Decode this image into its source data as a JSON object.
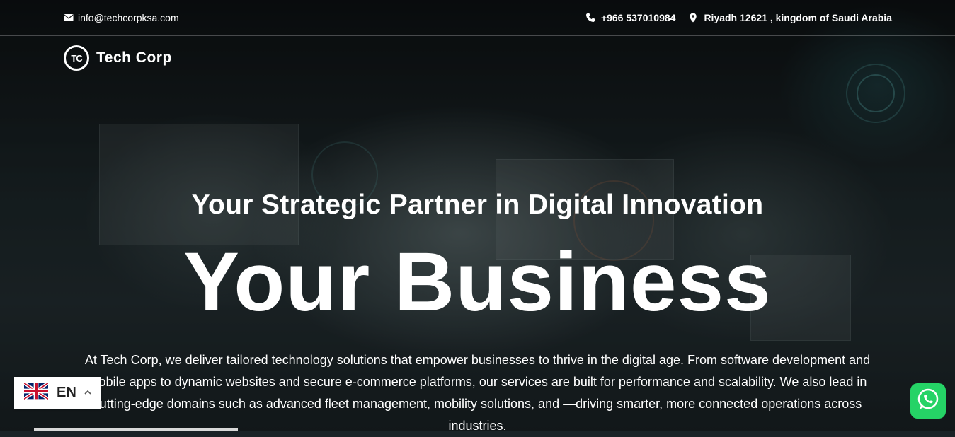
{
  "topbar": {
    "email": "info@techcorpksa.com",
    "phone": "+966 537010984",
    "address": "Riyadh 12621 , kingdom of Saudi Arabia"
  },
  "logo": {
    "mark": "TC",
    "name": "Tech Corp"
  },
  "hero": {
    "subtitle": "Your Strategic Partner in Digital Innovation",
    "title": "Your Business",
    "description": "At Tech Corp, we deliver tailored technology solutions that empower businesses to thrive in the digital age. From software development and mobile apps to dynamic websites and secure e-commerce platforms, our services are built for performance and scalability. We also lead in cutting-edge domains such as advanced fleet management, mobility solutions, and —driving smarter, more connected operations across industries."
  },
  "language": {
    "label": "EN",
    "flag": "uk-flag-icon"
  },
  "icons": {
    "email": "envelope-icon",
    "phone": "phone-icon",
    "address": "map-pin-icon",
    "chevron": "chevron-up-icon",
    "whatsapp": "whatsapp-icon"
  },
  "colors": {
    "whatsapp": "#25d366",
    "text": "#ffffff"
  }
}
